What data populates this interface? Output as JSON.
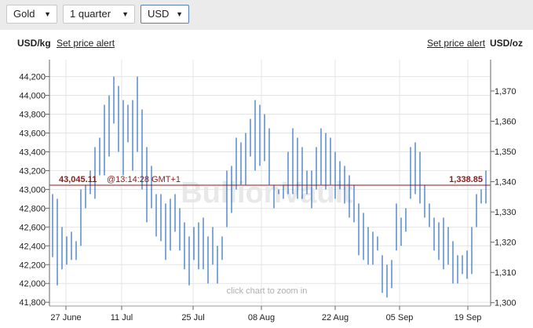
{
  "toolbar": {
    "metal": "Gold",
    "period": "1 quarter",
    "currency": "USD"
  },
  "header": {
    "left_unit": "USD/kg",
    "left_link": "Set price alert",
    "right_link": "Set price alert",
    "right_unit": "USD/oz"
  },
  "icons": {
    "dropdown": "chevron-down-icon"
  },
  "colors": {
    "series": "#2b6fc2",
    "price_line": "#8b1a1a",
    "watermark": "#e8e8e8",
    "grid": "#e4e4e4"
  },
  "chart_data": {
    "type": "ohlc",
    "watermark": "BullionVault",
    "hint": "click chart to zoom in",
    "current": {
      "left_value": "43,045.11",
      "time": "@13:14:28 GMT+1",
      "right_value": "1,338.85",
      "kg_value": 43045.11
    },
    "x_ticks": [
      "27 June",
      "11 Jul",
      "25 Jul",
      "08 Aug",
      "22 Aug",
      "05 Sep",
      "19 Sep"
    ],
    "y_left": {
      "label": "USD/kg",
      "range": [
        41760,
        44380
      ],
      "ticks": [
        41800,
        42000,
        42200,
        42400,
        42600,
        42800,
        43000,
        43200,
        43400,
        43600,
        43800,
        44000,
        44200
      ],
      "tick_labels": [
        "41,800",
        "42,000",
        "42,200",
        "42,400",
        "42,600",
        "42,800",
        "43,000",
        "43,200",
        "43,400",
        "43,600",
        "43,800",
        "44,000",
        "44,200"
      ]
    },
    "y_right": {
      "label": "USD/oz",
      "ticks": [
        1300,
        1310,
        1320,
        1330,
        1340,
        1350,
        1360,
        1370
      ],
      "tick_labels": [
        "1,300",
        "1,310",
        "1,320",
        "1,330",
        "1,340",
        "1,350",
        "1,360",
        "1,370"
      ]
    },
    "grid": true,
    "bars": [
      {
        "high": 42950,
        "low": 42280
      },
      {
        "high": 42900,
        "low": 41980
      },
      {
        "high": 42600,
        "low": 42150
      },
      {
        "high": 42500,
        "low": 42200
      },
      {
        "high": 42550,
        "low": 42250
      },
      {
        "high": 42450,
        "low": 42250
      },
      {
        "high": 43000,
        "low": 42400
      },
      {
        "high": 43050,
        "low": 42800
      },
      {
        "high": 43200,
        "low": 42950
      },
      {
        "high": 43450,
        "low": 42900
      },
      {
        "high": 43550,
        "low": 43150
      },
      {
        "high": 43900,
        "low": 43150
      },
      {
        "high": 44000,
        "low": 43350
      },
      {
        "high": 44200,
        "low": 43700
      },
      {
        "high": 44100,
        "low": 43400
      },
      {
        "high": 43950,
        "low": 43150
      },
      {
        "high": 43900,
        "low": 43500
      },
      {
        "high": 43950,
        "low": 43200
      },
      {
        "high": 44200,
        "low": 43400
      },
      {
        "high": 43850,
        "low": 43000
      },
      {
        "high": 43450,
        "low": 42650
      },
      {
        "high": 43250,
        "low": 42800
      },
      {
        "high": 42950,
        "low": 42500
      },
      {
        "high": 42950,
        "low": 42450
      },
      {
        "high": 42850,
        "low": 42250
      },
      {
        "high": 42900,
        "low": 42350
      },
      {
        "high": 42950,
        "low": 42550
      },
      {
        "high": 42800,
        "low": 42350
      },
      {
        "high": 42650,
        "low": 42150
      },
      {
        "high": 42500,
        "low": 41980
      },
      {
        "high": 42600,
        "low": 42250
      },
      {
        "high": 42650,
        "low": 42150
      },
      {
        "high": 42700,
        "low": 42150
      },
      {
        "high": 42500,
        "low": 42000
      },
      {
        "high": 42600,
        "low": 42200
      },
      {
        "high": 42400,
        "low": 42000
      },
      {
        "high": 42500,
        "low": 42250
      },
      {
        "high": 43200,
        "low": 42600
      },
      {
        "high": 43250,
        "low": 42750
      },
      {
        "high": 43550,
        "low": 43000
      },
      {
        "high": 43500,
        "low": 43050
      },
      {
        "high": 43600,
        "low": 43050
      },
      {
        "high": 43750,
        "low": 43350
      },
      {
        "high": 43950,
        "low": 43200
      },
      {
        "high": 43900,
        "low": 43250
      },
      {
        "high": 43800,
        "low": 43300
      },
      {
        "high": 43650,
        "low": 43050
      },
      {
        "high": 43050,
        "low": 42800
      },
      {
        "high": 43000,
        "low": 42950
      },
      {
        "high": 43050,
        "low": 42900
      },
      {
        "high": 43400,
        "low": 42950
      },
      {
        "high": 43650,
        "low": 42950
      },
      {
        "high": 43550,
        "low": 42900
      },
      {
        "high": 43450,
        "low": 42900
      },
      {
        "high": 43200,
        "low": 42950
      },
      {
        "high": 43200,
        "low": 42800
      },
      {
        "high": 43450,
        "low": 43000
      },
      {
        "high": 43650,
        "low": 43050
      },
      {
        "high": 43600,
        "low": 43000
      },
      {
        "high": 43550,
        "low": 43050
      },
      {
        "high": 43400,
        "low": 42900
      },
      {
        "high": 43300,
        "low": 43000
      },
      {
        "high": 43250,
        "low": 42850
      },
      {
        "high": 43150,
        "low": 42700
      },
      {
        "high": 43050,
        "low": 42650
      },
      {
        "high": 42850,
        "low": 42300
      },
      {
        "high": 42750,
        "low": 42250
      },
      {
        "high": 42600,
        "low": 42200
      },
      {
        "high": 42550,
        "low": 42200
      },
      {
        "high": 42500,
        "low": 42350
      },
      {
        "high": 42300,
        "low": 41900
      },
      {
        "high": 42200,
        "low": 41850
      },
      {
        "high": 42250,
        "low": 41950
      },
      {
        "high": 42850,
        "low": 42350
      },
      {
        "high": 42700,
        "low": 42400
      },
      {
        "high": 42800,
        "low": 42550
      },
      {
        "high": 43450,
        "low": 42900
      },
      {
        "high": 43500,
        "low": 42950
      },
      {
        "high": 43400,
        "low": 42850
      },
      {
        "high": 43050,
        "low": 42700
      },
      {
        "high": 42850,
        "low": 42600
      },
      {
        "high": 42700,
        "low": 42350
      },
      {
        "high": 42650,
        "low": 42250
      },
      {
        "high": 42700,
        "low": 42150
      },
      {
        "high": 42600,
        "low": 42200
      },
      {
        "high": 42450,
        "low": 42000
      },
      {
        "high": 42300,
        "low": 42000
      },
      {
        "high": 42300,
        "low": 42100
      },
      {
        "high": 42350,
        "low": 42050
      },
      {
        "high": 42600,
        "low": 42100
      },
      {
        "high": 42950,
        "low": 42600
      },
      {
        "high": 43000,
        "low": 42850
      },
      {
        "high": 43200,
        "low": 42850
      }
    ]
  }
}
